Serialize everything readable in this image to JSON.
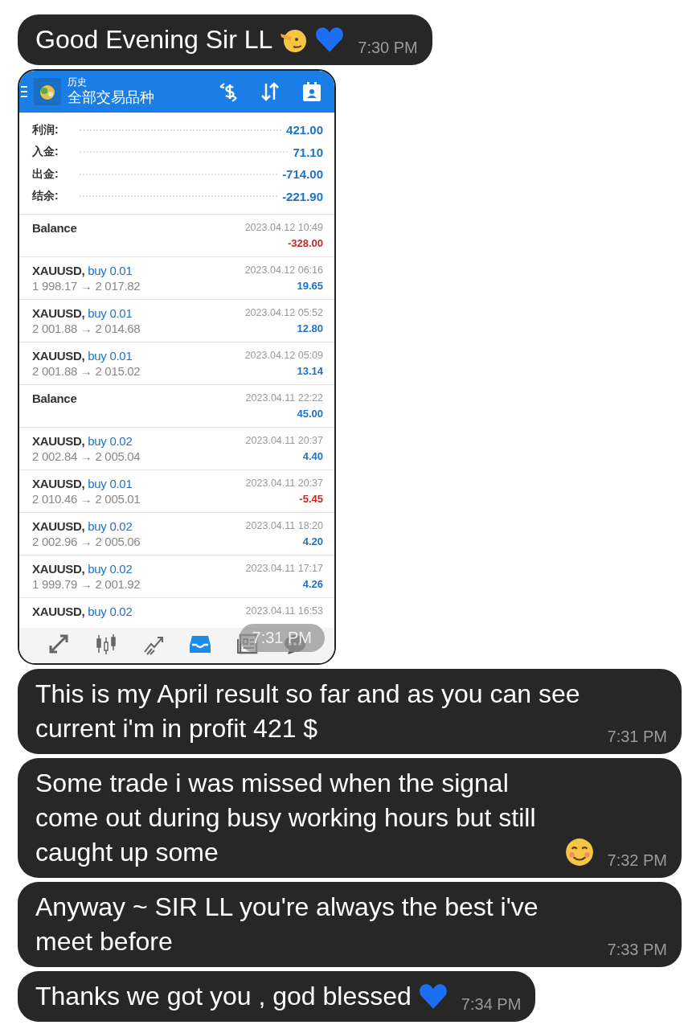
{
  "messages": [
    {
      "kind": "text",
      "text": "Good Evening Sir LL",
      "emoji": [
        {
          "kind": "salute"
        },
        {
          "kind": "heart"
        }
      ],
      "time": "7:30 PM"
    },
    {
      "kind": "screenshot",
      "time": "7:31 PM"
    },
    {
      "kind": "text",
      "text": "This is my April result so far and as you can see current i'm in profit 421 $",
      "time": "7:31 PM"
    },
    {
      "kind": "text",
      "text": "Some trade i was missed when the signal come out during busy working hours but still caught up some",
      "emoji": [
        {
          "kind": "smile"
        }
      ],
      "time": "7:32 PM"
    },
    {
      "kind": "text",
      "text": "Anyway ~ SIR LL you're always the best i've meet before",
      "time": "7:33 PM"
    },
    {
      "kind": "text",
      "text": "Thanks we got you , god blessed",
      "emoji": [
        {
          "kind": "heart"
        }
      ],
      "time": "7:34 PM"
    }
  ],
  "app": {
    "header": {
      "subtitle": "历史",
      "title": "全部交易品种"
    },
    "summary": [
      {
        "label": "利润:",
        "value": "421.00"
      },
      {
        "label": "入金:",
        "value": "71.10"
      },
      {
        "label": "出金:",
        "value": "-714.00"
      },
      {
        "label": "结余:",
        "value": "-221.90"
      }
    ],
    "rows": [
      {
        "kind": "balance",
        "title": "Balance",
        "time": "2023.04.12 10:49",
        "profit": "-328.00",
        "negative": true
      },
      {
        "kind": "trade",
        "symbol": "XAUUSD,",
        "side": "buy 0.01",
        "prices": "1 998.17 → 2 017.82",
        "time": "2023.04.12 06:16",
        "profit": "19.65",
        "negative": false
      },
      {
        "kind": "trade",
        "symbol": "XAUUSD,",
        "side": "buy 0.01",
        "prices": "2 001.88 → 2 014.68",
        "time": "2023.04.12 05:52",
        "profit": "12.80",
        "negative": false
      },
      {
        "kind": "trade",
        "symbol": "XAUUSD,",
        "side": "buy 0.01",
        "prices": "2 001.88 → 2 015.02",
        "time": "2023.04.12 05:09",
        "profit": "13.14",
        "negative": false
      },
      {
        "kind": "balance",
        "title": "Balance",
        "time": "2023.04.11 22:22",
        "profit": "45.00",
        "negative": false
      },
      {
        "kind": "trade",
        "symbol": "XAUUSD,",
        "side": "buy 0.02",
        "prices": "2 002.84 → 2 005.04",
        "time": "2023.04.11 20:37",
        "profit": "4.40",
        "negative": false
      },
      {
        "kind": "trade",
        "symbol": "XAUUSD,",
        "side": "buy 0.01",
        "prices": "2 010.46 → 2 005.01",
        "time": "2023.04.11 20:37",
        "profit": "-5.45",
        "negative": true
      },
      {
        "kind": "trade",
        "symbol": "XAUUSD,",
        "side": "buy 0.02",
        "prices": "2 002.96 → 2 005.06",
        "time": "2023.04.11 18:20",
        "profit": "4.20",
        "negative": false
      },
      {
        "kind": "trade",
        "symbol": "XAUUSD,",
        "side": "buy 0.02",
        "prices": "1 999.79 → 2 001.92",
        "time": "2023.04.11 17:17",
        "profit": "4.26",
        "negative": false
      },
      {
        "kind": "trade",
        "symbol": "XAUUSD,",
        "side": "buy 0.02",
        "time": "2023.04.11 16:53"
      }
    ],
    "nav": [
      {
        "kind": "quotes",
        "selected": false
      },
      {
        "kind": "chart",
        "selected": false
      },
      {
        "kind": "trade",
        "selected": false
      },
      {
        "kind": "history",
        "selected": true
      },
      {
        "kind": "news",
        "selected": false
      },
      {
        "kind": "chat",
        "selected": false
      }
    ]
  }
}
